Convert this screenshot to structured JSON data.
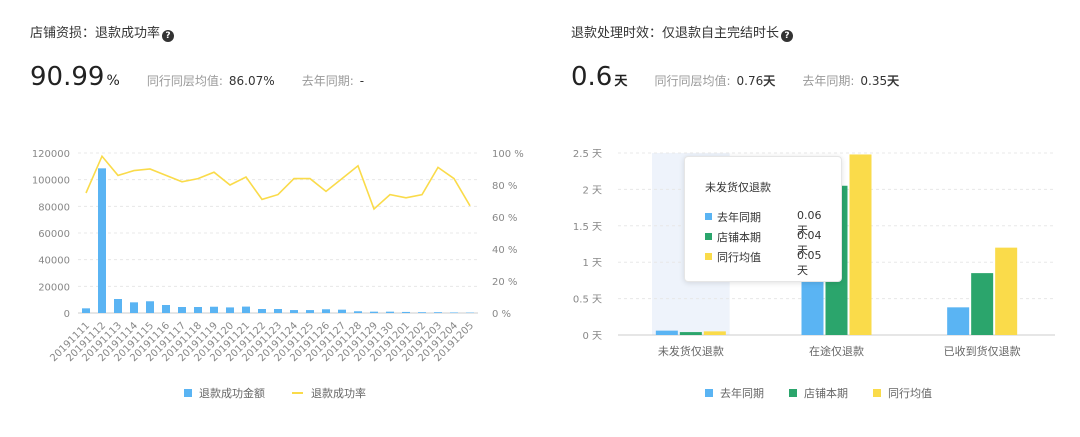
{
  "left": {
    "title": "店铺资损：退款成功率",
    "help_icon": "?",
    "big_value": "90.99",
    "big_unit": "%",
    "peer_label": "同行同层均值:",
    "peer_value": "86.07%",
    "yoy_label": "去年同期:",
    "yoy_value": "-"
  },
  "right": {
    "title": "退款处理时效：仅退款自主完结时长",
    "help_icon": "?",
    "big_value": "0.6",
    "big_unit": "天",
    "peer_label": "同行同层均值:",
    "peer_value": "0.76",
    "peer_unit": "天",
    "yoy_label": "去年同期:",
    "yoy_value": "0.35",
    "yoy_unit": "天"
  },
  "colors": {
    "blue": "#5ab4f3",
    "yellow": "#fadb4a",
    "green": "#2ba56c",
    "line": "#fadb4a",
    "highlight": "#eef3fb"
  },
  "chart_data": [
    {
      "type": "bar",
      "categories": [
        "20191111",
        "20191112",
        "20191113",
        "20191114",
        "20191115",
        "20191116",
        "20191117",
        "20191118",
        "20191119",
        "20191120",
        "20191121",
        "20191122",
        "20191123",
        "20191124",
        "20191125",
        "20191126",
        "20191127",
        "20191128",
        "20191129",
        "20191130",
        "20191201",
        "20191202",
        "20191203",
        "20191204",
        "20191205"
      ],
      "y_ticks": [
        "0",
        "20000",
        "40000",
        "60000",
        "80000",
        "100000",
        "120000"
      ],
      "y2_ticks": [
        "0 %",
        "20 %",
        "40 %",
        "60 %",
        "80 %",
        "100 %"
      ],
      "ylim": [
        0,
        120000
      ],
      "y2lim": [
        0,
        100
      ],
      "series": [
        {
          "name": "退款成功金额",
          "kind": "bar",
          "axis": "left",
          "values": [
            3500,
            108500,
            10500,
            8000,
            8800,
            6000,
            4500,
            4500,
            4700,
            4200,
            4800,
            3000,
            3000,
            2200,
            2200,
            2800,
            2500,
            1300,
            1000,
            1000,
            800,
            600,
            600,
            400,
            300
          ]
        },
        {
          "name": "退款成功率",
          "kind": "line",
          "axis": "right",
          "values": [
            75,
            98,
            86,
            89,
            90,
            86,
            82,
            84,
            88,
            80,
            85,
            71,
            74,
            84,
            84,
            76,
            84,
            92,
            65,
            74,
            72,
            74,
            91,
            84,
            67
          ]
        }
      ],
      "grid": true,
      "legend": "bottom-center"
    },
    {
      "type": "bar",
      "categories": [
        "未发货仅退款",
        "在途仅退款",
        "已收到货仅退款"
      ],
      "y_ticks": [
        "0 天",
        "0.5 天",
        "1 天",
        "1.5 天",
        "2 天",
        "2.5 天"
      ],
      "ylim": [
        0,
        2.5
      ],
      "series": [
        {
          "name": "去年同期",
          "color_key": "blue",
          "values": [
            0.06,
            1.93,
            0.38
          ]
        },
        {
          "name": "店铺本期",
          "color_key": "green",
          "values": [
            0.04,
            2.05,
            0.85
          ]
        },
        {
          "name": "同行均值",
          "color_key": "yellow",
          "values": [
            0.05,
            2.48,
            1.2
          ]
        }
      ],
      "highlighted_category": "未发货仅退款",
      "grid": true,
      "legend": "bottom-center",
      "tooltip": {
        "title": "未发货仅退款",
        "rows": [
          {
            "name": "去年同期",
            "value": "0.06天"
          },
          {
            "name": "店铺本期",
            "value": "0.04天"
          },
          {
            "name": "同行均值",
            "value": "0.05天"
          }
        ]
      }
    }
  ]
}
